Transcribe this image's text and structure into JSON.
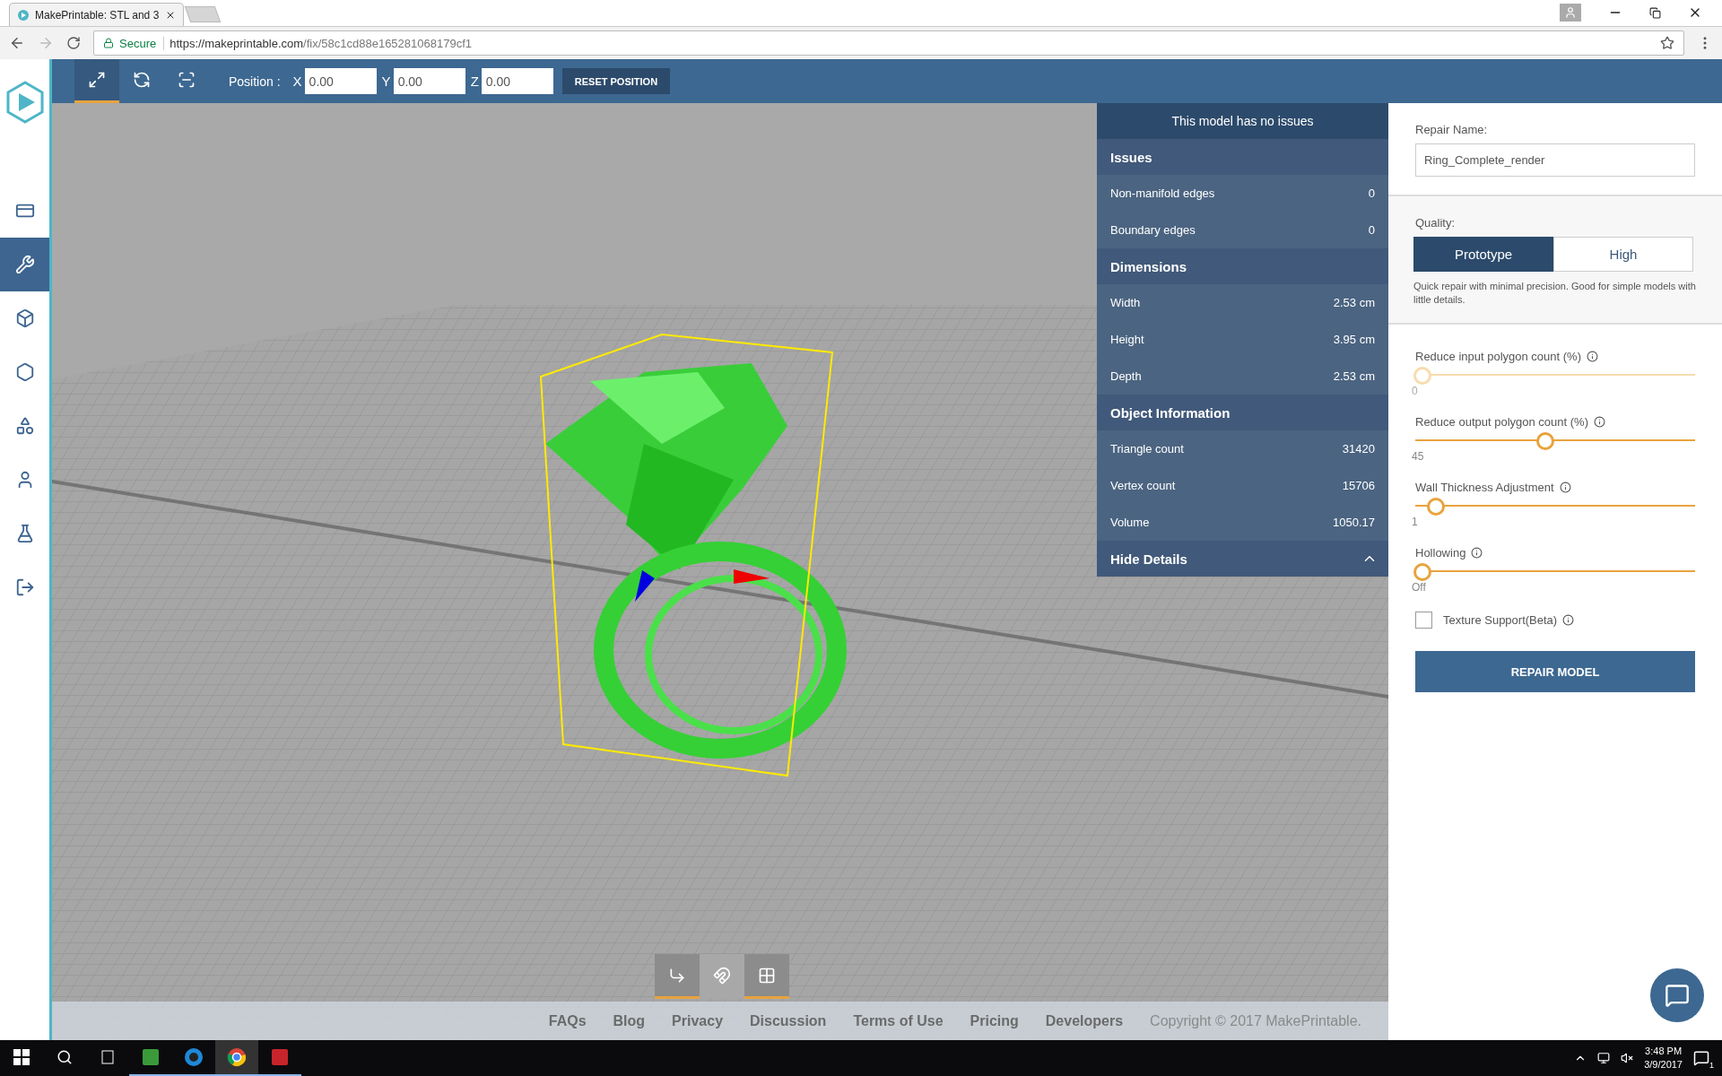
{
  "browser": {
    "tabs": [
      {
        "title": "MakePrintable: STL and 3",
        "selected": true
      }
    ],
    "secure_label": "Secure",
    "url_host": "https://makeprintable.com",
    "url_path": "/fix/58c1cd88e165281068179cf1"
  },
  "toolbar": {
    "tools": [
      {
        "selected": true
      },
      {
        "selected": false
      },
      {
        "selected": false
      }
    ],
    "position_label": "Position :",
    "axes": [
      {
        "label": "X",
        "value": "0.00"
      },
      {
        "label": "Y",
        "value": "0.00"
      },
      {
        "label": "Z",
        "value": "0.00"
      }
    ],
    "reset_button": "RESET POSITION"
  },
  "sidebar": {
    "items": [
      {
        "selected": false
      },
      {
        "selected": true
      },
      {
        "selected": false
      },
      {
        "selected": false
      },
      {
        "selected": false
      },
      {
        "selected": false
      },
      {
        "selected": false
      },
      {
        "selected": false
      }
    ]
  },
  "details": {
    "banner": "This model has no issues",
    "expanded": true,
    "toggle": "Hide Details",
    "sections": [
      {
        "title": "Issues",
        "rows": [
          {
            "label": "Non-manifold edges",
            "value": "0"
          },
          {
            "label": "Boundary edges",
            "value": "0"
          }
        ]
      },
      {
        "title": "Dimensions",
        "rows": [
          {
            "label": "Width",
            "value": "2.53 cm"
          },
          {
            "label": "Height",
            "value": "3.95 cm"
          },
          {
            "label": "Depth",
            "value": "2.53 cm"
          }
        ]
      },
      {
        "title": "Object Information",
        "rows": [
          {
            "label": "Triangle count",
            "value": "31420"
          },
          {
            "label": "Vertex count",
            "value": "15706"
          },
          {
            "label": "Volume",
            "value": "1050.17"
          }
        ]
      }
    ]
  },
  "bottom_tools": [
    {
      "selected": true
    },
    {
      "selected": false
    },
    {
      "selected": true
    }
  ],
  "footer": {
    "links": [
      "FAQs",
      "Blog",
      "Privacy",
      "Discussion",
      "Terms of Use",
      "Pricing",
      "Developers"
    ],
    "copyright": "Copyright © 2017 MakePrintable."
  },
  "repair": {
    "name_label": "Repair Name:",
    "name_value": "Ring_Complete_render",
    "quality_label": "Quality:",
    "quality_options": [
      {
        "label": "Prototype",
        "selected": true
      },
      {
        "label": "High",
        "selected": false
      }
    ],
    "quality_hint": "Quick repair with minimal precision. Good for simple models with little details.",
    "sliders": [
      {
        "label": "Reduce input polygon count (%)",
        "level": 0,
        "reading": "0",
        "disabled": true
      },
      {
        "label": "Reduce output polygon count (%)",
        "level": 0.47,
        "reading": "45",
        "disabled": false
      },
      {
        "label": "Wall Thickness Adjustment",
        "level": 0.05,
        "reading": "1",
        "disabled": false
      },
      {
        "label": "Hollowing",
        "level": 0,
        "reading": "Off",
        "disabled": false
      }
    ],
    "texture": {
      "label": "Texture Support(Beta)",
      "checked": false
    },
    "repair_button": "REPAIR MODEL"
  },
  "taskbar": {
    "time": "3:48 PM",
    "date": "3/9/2017",
    "notification_count": "1"
  }
}
